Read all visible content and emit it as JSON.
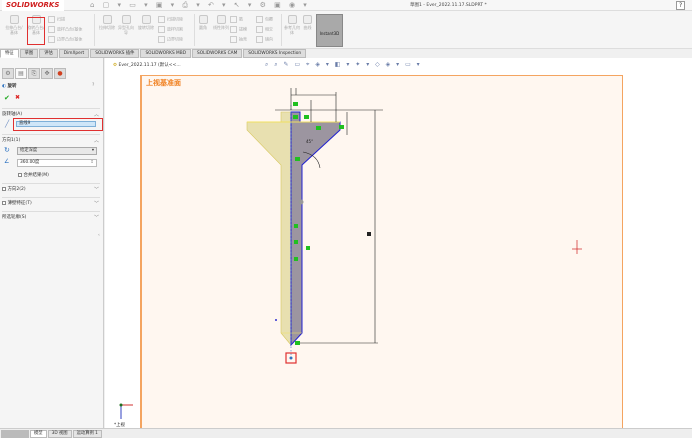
{
  "app": {
    "logo": "SOLIDWORKS",
    "title": "草图1 - Ever_2022.11.17.SLDPRT *",
    "help": "?"
  },
  "ribbon": {
    "revolve_boss": "旋转凸台/基体",
    "extrude_boss": "拉伸凸台/基体",
    "sweep": "扫描",
    "loft_boss": "放样凸台/基体",
    "boundary_boss": "边界凸台/基体",
    "extrude_cut": "拉伸切除",
    "hole_wizard": "异型孔向导",
    "revolve_cut": "旋转切除",
    "sweep_cut": "扫描切除",
    "loft_cut": "放样切割",
    "boundary_cut": "边界切除",
    "fillet": "圆角",
    "linear_pattern": "线性阵列",
    "rib": "筋",
    "draft": "拔模",
    "shell": "抽壳",
    "wrap": "包覆",
    "intersect": "相交",
    "mirror": "镜向",
    "ref_geometry": "参考几何体",
    "curves": "曲线",
    "instant3d": "Instant3D"
  },
  "tabs": [
    "特征",
    "草图",
    "评估",
    "DimXpert",
    "SOLIDWORKS 插件",
    "SOLIDWORKS MBD",
    "SOLIDWORKS CAM",
    "SOLIDWORKS Inspection"
  ],
  "active_tab": "特征",
  "panel": {
    "title": "旋转",
    "help": "?",
    "ok": "✔",
    "cancel": "✖",
    "axis_section": "旋转轴(A)",
    "axis_value": "直线9",
    "dir1_section": "方向1(1)",
    "end_condition": "给定深度",
    "angle": "360.00度",
    "merge_result": "合并结果(M)",
    "dir2_section": "方向2(2)",
    "thin_section": "薄壁特征(T)",
    "contours_section": "所选轮廓(S)"
  },
  "graphics": {
    "tree_item": "Ever_2022.11.17 (默认<<...",
    "plane_label": "上视基准面",
    "view_orientation": "*上视",
    "angle_dim": "45°"
  },
  "bottom_tabs": [
    "模型",
    "3D 视图",
    "运动算例 1"
  ],
  "colors": {
    "accent_red": "#e03030",
    "plane_orange": "#f08020",
    "sketch_blue": "#2020d0",
    "relation_green": "#20c020"
  }
}
